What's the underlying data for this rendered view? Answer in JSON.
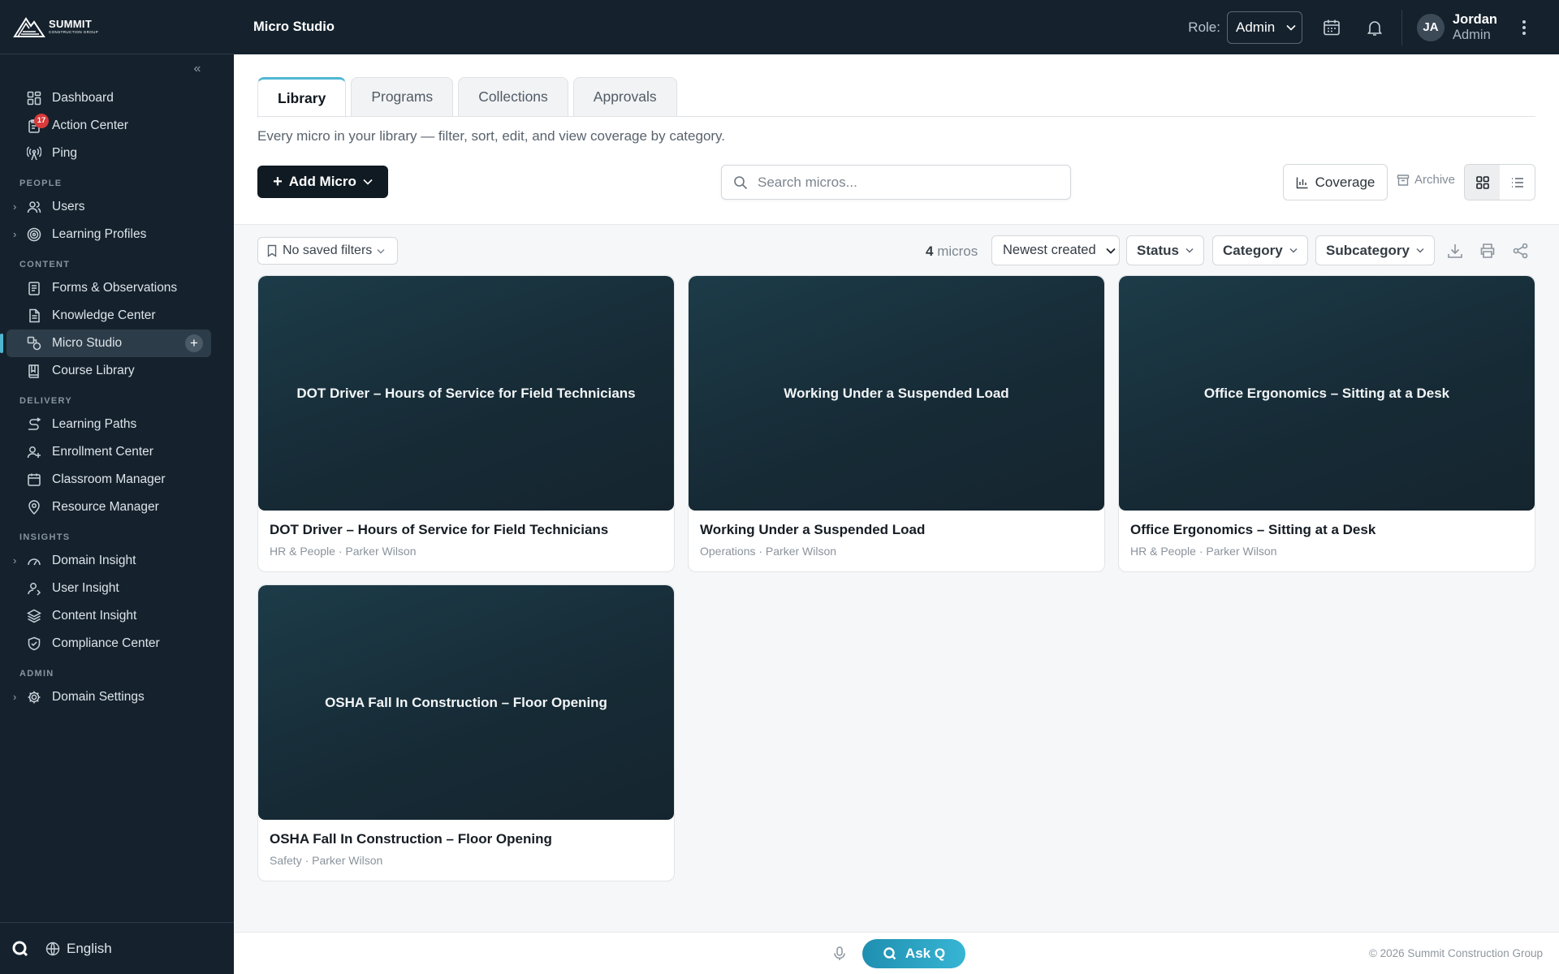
{
  "brand": {
    "name": "SUMMIT",
    "tagline": "CONSTRUCTION GROUP"
  },
  "topbar": {
    "title": "Micro Studio",
    "role_label": "Role:",
    "role_value": "Admin",
    "user_initials": "JA",
    "user_name": "Jordan",
    "user_role": "Admin"
  },
  "sidebar": {
    "items_top": [
      {
        "label": "Dashboard",
        "icon": "dashboard-icon"
      },
      {
        "label": "Action Center",
        "icon": "clipboard-icon",
        "badge": "17"
      },
      {
        "label": "Ping",
        "icon": "broadcast-icon"
      }
    ],
    "sections": [
      {
        "title": "PEOPLE",
        "items": [
          {
            "label": "Users"
          },
          {
            "label": "Learning Profiles"
          }
        ]
      },
      {
        "title": "CONTENT",
        "items": [
          {
            "label": "Forms & Observations"
          },
          {
            "label": "Knowledge Center"
          },
          {
            "label": "Micro Studio"
          },
          {
            "label": "Course Library"
          }
        ]
      },
      {
        "title": "DELIVERY",
        "items": [
          {
            "label": "Learning Paths"
          },
          {
            "label": "Enrollment Center"
          },
          {
            "label": "Classroom Manager"
          },
          {
            "label": "Resource Manager"
          }
        ]
      },
      {
        "title": "INSIGHTS",
        "items": [
          {
            "label": "Domain Insight"
          },
          {
            "label": "User Insight"
          },
          {
            "label": "Content Insight"
          },
          {
            "label": "Compliance Center"
          }
        ]
      },
      {
        "title": "ADMIN",
        "items": [
          {
            "label": "Domain Settings"
          }
        ]
      }
    ],
    "language": "English"
  },
  "tabs": [
    "Library",
    "Programs",
    "Collections",
    "Approvals"
  ],
  "subtitle": "Every micro in your library — filter, sort, edit, and view coverage by category.",
  "toolbar": {
    "add_label": "Add Micro",
    "search_placeholder": "Search micros...",
    "coverage_label": "Coverage",
    "archive_label": "Archive"
  },
  "filters": {
    "saved": "No saved filters",
    "count": "4",
    "count_unit": "micros",
    "sort": "Newest created",
    "status": "Status",
    "category": "Category",
    "subcategory": "Subcategory"
  },
  "micros": [
    {
      "title": "DOT Driver – Hours of Service for Field Technicians",
      "meta": "HR & People · Parker Wilson"
    },
    {
      "title": "Working Under a Suspended Load",
      "meta": "Operations · Parker Wilson"
    },
    {
      "title": "Office Ergonomics – Sitting at a Desk",
      "meta": "HR & People · Parker Wilson"
    },
    {
      "title": "OSHA Fall In Construction – Floor Opening",
      "meta": "Safety · Parker Wilson"
    }
  ],
  "footer": {
    "ask_label": "Ask Q",
    "copyright": "© 2026 Summit Construction Group"
  },
  "colors": {
    "sidebar_bg": "#15222d",
    "accent": "#4fb7d3",
    "card_thumb": "#1c3b48",
    "badge": "#d93a3a"
  }
}
